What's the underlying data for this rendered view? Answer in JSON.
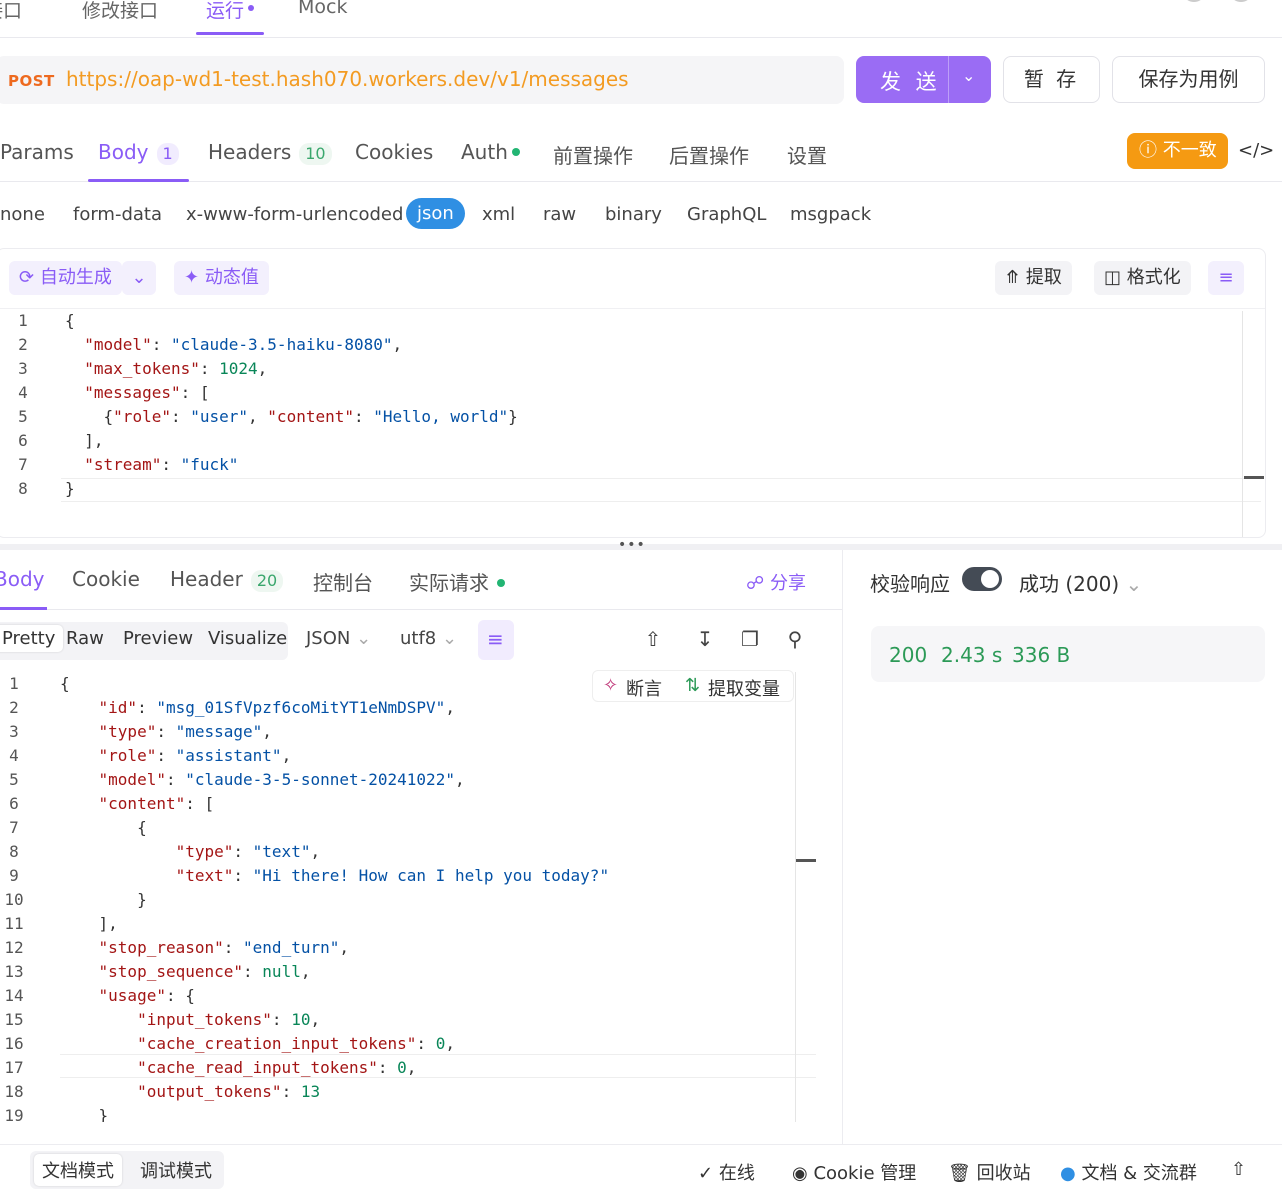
{
  "top_tabs": [
    {
      "label": "接口"
    },
    {
      "label": "修改接口"
    },
    {
      "label": "运行"
    },
    {
      "label": "Mock"
    }
  ],
  "request": {
    "method": "POST",
    "url": "https://oap-wd1-test.hash070.workers.dev/v1/messages",
    "send_label": "发 送",
    "save_label": "暂 存",
    "save_case_label": "保存为用例"
  },
  "req_tabs": {
    "params": "Params",
    "body": "Body",
    "body_count": "1",
    "headers": "Headers",
    "headers_count": "10",
    "cookies": "Cookies",
    "auth": "Auth",
    "pre": "前置操作",
    "post": "后置操作",
    "settings": "设置"
  },
  "mismatch_label": "不一致",
  "body_types": [
    "none",
    "form-data",
    "x-www-form-urlencoded",
    "json",
    "xml",
    "raw",
    "binary",
    "GraphQL",
    "msgpack"
  ],
  "editor_toolbar": {
    "auto_generate": "自动生成",
    "dynamic_value": "动态值",
    "extract": "提取",
    "format": "格式化"
  },
  "request_body_lines": [
    "{",
    "  \"model\": \"claude-3.5-haiku-8080\",",
    "  \"max_tokens\": 1024,",
    "  \"messages\": [",
    "    {\"role\": \"user\", \"content\": \"Hello, world\"}",
    "  ],",
    "  \"stream\": \"fuck\"",
    "}"
  ],
  "resp_tabs": {
    "body": "Body",
    "cookie": "Cookie",
    "header": "Header",
    "header_count": "20",
    "console": "控制台",
    "actual_request": "实际请求",
    "share": "分享"
  },
  "view_modes": [
    "Pretty",
    "Raw",
    "Preview",
    "Visualize"
  ],
  "format_select": "JSON",
  "encoding_select": "utf8",
  "assert_label": "断言",
  "extract_var_label": "提取变量",
  "response_lines": [
    "{",
    "    \"id\": \"msg_01SfVpzf6coMitYT1eNmDSPV\",",
    "    \"type\": \"message\",",
    "    \"role\": \"assistant\",",
    "    \"model\": \"claude-3-5-sonnet-20241022\",",
    "    \"content\": [",
    "        {",
    "            \"type\": \"text\",",
    "            \"text\": \"Hi there! How can I help you today?\"",
    "        }",
    "    ],",
    "    \"stop_reason\": \"end_turn\",",
    "    \"stop_sequence\": null,",
    "    \"usage\": {",
    "        \"input_tokens\": 10,",
    "        \"cache_creation_input_tokens\": 0,",
    "        \"cache_read_input_tokens\": 0,",
    "        \"output_tokens\": 13",
    "    }"
  ],
  "verify_label": "校验响应",
  "success_label": "成功 (200)",
  "stats": {
    "status": "200",
    "time": "2.43 s",
    "size": "336 B"
  },
  "footer": {
    "doc_mode": "文档模式",
    "debug_mode": "调试模式",
    "online": "在线",
    "cookie_mgmt": "Cookie 管理",
    "recycle": "回收站",
    "docs_group": "文档 & 交流群"
  },
  "colors": {
    "accent": "#8a5cf6",
    "warning": "#f59a12",
    "success": "#2c9a57",
    "url": "#f39b22"
  }
}
